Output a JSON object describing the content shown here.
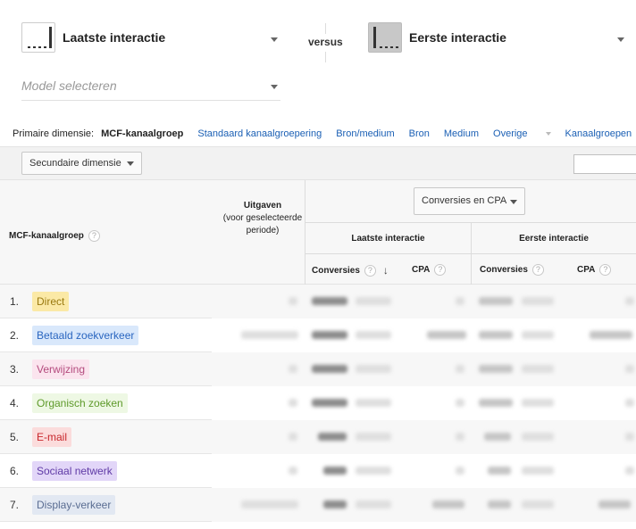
{
  "models": {
    "left": {
      "name": "Laatste interactie",
      "icon": "last-interaction-icon"
    },
    "versus": "versus",
    "right": {
      "name": "Eerste interactie",
      "icon": "first-interaction-icon"
    },
    "placeholder": "Model selecteren"
  },
  "dimensions": {
    "label": "Primaire dimensie:",
    "active": "MCF-kanaalgroep",
    "links": [
      "Standaard kanaalgroepering",
      "Bron/medium",
      "Bron",
      "Medium"
    ],
    "other": "Overige",
    "groups": "Kanaalgroepen"
  },
  "toolbar": {
    "secondary": "Secundaire dimensie"
  },
  "table": {
    "col_dimension": "MCF-kanaalgroep",
    "col_spend_title": "Uitgaven",
    "col_spend_sub": "(voor geselecteerde periode)",
    "metric_select": "Conversies en CPA",
    "group_left": "Laatste interactie",
    "group_right": "Eerste interactie",
    "sub_conversions": "Conversies",
    "sub_cpa": "CPA",
    "help": "?",
    "rows": [
      {
        "num": "1.",
        "label": "Direct",
        "bg": "#fbe9a6",
        "fg": "#9a7a10"
      },
      {
        "num": "2.",
        "label": "Betaald zoekverkeer",
        "bg": "#d9e8fb",
        "fg": "#2a66c0"
      },
      {
        "num": "3.",
        "label": "Verwijzing",
        "bg": "#fbe4ee",
        "fg": "#b44b7e"
      },
      {
        "num": "4.",
        "label": "Organisch zoeken",
        "bg": "#eef8e4",
        "fg": "#5e9a2a"
      },
      {
        "num": "5.",
        "label": "E-mail",
        "bg": "#fbdcdc",
        "fg": "#c8262b"
      },
      {
        "num": "6.",
        "label": "Sociaal netwerk",
        "bg": "#e2d6f8",
        "fg": "#5f3aa6"
      },
      {
        "num": "7.",
        "label": "Display-verkeer",
        "bg": "#e2e8f2",
        "fg": "#5a6d92"
      }
    ]
  }
}
